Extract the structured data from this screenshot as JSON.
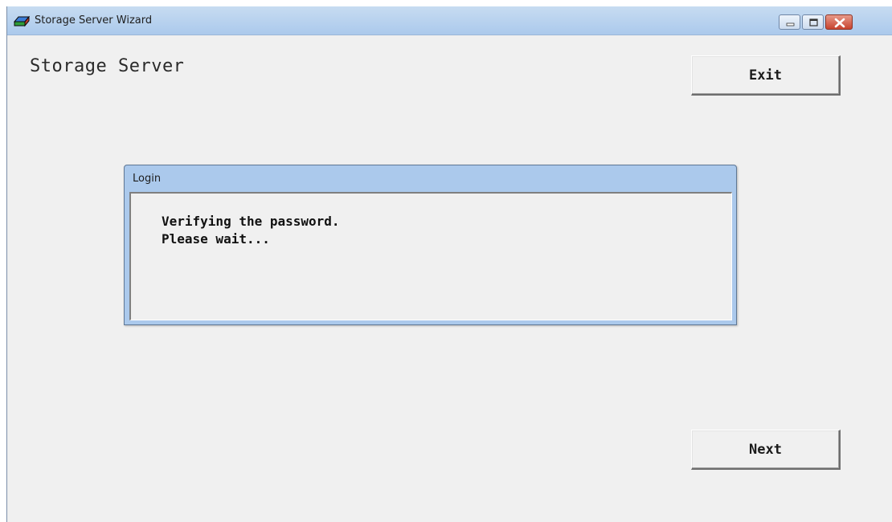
{
  "window": {
    "title": "Storage Server Wizard",
    "icon": "storage-server-icon"
  },
  "main": {
    "heading": "Storage Server",
    "exit_label": "Exit",
    "next_label": "Next"
  },
  "dialog": {
    "title": "Login",
    "message_line1": "Verifying the password.",
    "message_line2": "Please wait..."
  },
  "colors": {
    "titlebar": "#abc9ec",
    "background": "#f0f0f0",
    "close_button": "#c8432f"
  }
}
